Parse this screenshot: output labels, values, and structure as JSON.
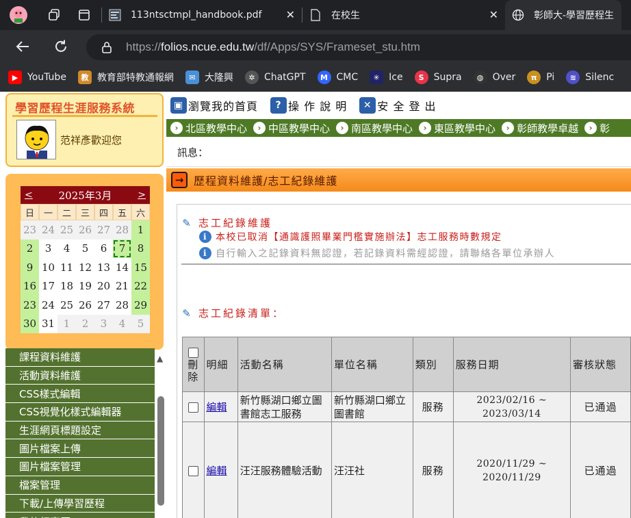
{
  "browser": {
    "tabs": [
      {
        "title": "113ntsctmpl_handbook.pdf",
        "icon": "pdf-icon"
      },
      {
        "title": "在校生",
        "icon": "document-icon"
      },
      {
        "title": "彰師大-學習歷程生",
        "icon": "globe-icon",
        "active": true
      }
    ],
    "url_prefix": "https://",
    "url_domain": "folios.ncue.edu.tw",
    "url_path": "/df/Apps/SYS/Frameset_stu.htm",
    "bookmarks": [
      {
        "label": "YouTube",
        "color": "#ff0000"
      },
      {
        "label": "教育部特教通報網",
        "color": "#d08a2a"
      },
      {
        "label": "大隆興",
        "color": "#4a90d9"
      },
      {
        "label": "ChatGPT",
        "color": "#555555"
      },
      {
        "label": "CMC",
        "color": "#3366ff"
      },
      {
        "label": "Ice",
        "color": "#222266"
      },
      {
        "label": "Supra",
        "color": "#e8344a"
      },
      {
        "label": "Over",
        "color": "#333333"
      },
      {
        "label": "Pi",
        "color": "#c89020"
      },
      {
        "label": "Silenc",
        "color": "#5050c8"
      }
    ]
  },
  "sidebar": {
    "system_title": "學習歷程生涯服務系統",
    "welcome": "范祥彥歡迎您",
    "calendar": {
      "prev": "<",
      "next": ">",
      "month_label": "2025年3月",
      "weekdays": [
        "日",
        "一",
        "二",
        "三",
        "四",
        "五",
        "六"
      ],
      "days": [
        [
          "23",
          "other"
        ],
        [
          "24",
          "other"
        ],
        [
          "25",
          "other"
        ],
        [
          "26",
          "other"
        ],
        [
          "27",
          "other"
        ],
        [
          "28",
          "other"
        ],
        [
          "1",
          "wkend"
        ],
        [
          "2",
          "wkend"
        ],
        [
          "3",
          ""
        ],
        [
          "4",
          ""
        ],
        [
          "5",
          ""
        ],
        [
          "6",
          ""
        ],
        [
          "7",
          "today"
        ],
        [
          "8",
          "wkend"
        ],
        [
          "9",
          "wkend"
        ],
        [
          "10",
          ""
        ],
        [
          "11",
          ""
        ],
        [
          "12",
          ""
        ],
        [
          "13",
          ""
        ],
        [
          "14",
          ""
        ],
        [
          "15",
          "wkend"
        ],
        [
          "16",
          "wkend"
        ],
        [
          "17",
          ""
        ],
        [
          "18",
          ""
        ],
        [
          "19",
          ""
        ],
        [
          "20",
          ""
        ],
        [
          "21",
          ""
        ],
        [
          "22",
          "wkend"
        ],
        [
          "23",
          "wkend"
        ],
        [
          "24",
          ""
        ],
        [
          "25",
          ""
        ],
        [
          "26",
          ""
        ],
        [
          "27",
          ""
        ],
        [
          "28",
          ""
        ],
        [
          "29",
          "wkend"
        ],
        [
          "30",
          "wkend"
        ],
        [
          "31",
          ""
        ],
        [
          "1",
          "other"
        ],
        [
          "2",
          "other"
        ],
        [
          "3",
          "other"
        ],
        [
          "4",
          "other"
        ],
        [
          "5",
          "other"
        ]
      ]
    },
    "menu": [
      "課程資料維護",
      "活動資料維護",
      "CSS樣式編輯",
      "CSS視覺化樣式編輯器",
      "生涯網頁標題設定",
      "圖片檔案上傳",
      "圖片檔案管理",
      "檔案管理",
      "下載/上傳學習歷程",
      "我的行事曆"
    ]
  },
  "toolbar": {
    "home": "瀏覽我的首頁",
    "help": "操 作 說 明",
    "logout": "安 全 登 出"
  },
  "centers": [
    "北區教學中心",
    "中區教學中心",
    "南區教學中心",
    "東區教學中心",
    "彰師教學卓越",
    "彰"
  ],
  "message_label": "訊息：",
  "section_title": "歷程資料維護/志工紀錄維護",
  "content": {
    "heading": "志工紀錄維護",
    "notice1": "本校已取消【通識護照畢業門檻實施辦法】志工服務時數規定",
    "notice2": "自行輸入之記錄資料無認證，若記錄資料需經認證，請聯絡各單位承辦人",
    "list_heading": "志工紀錄清單："
  },
  "table": {
    "headers": {
      "delete": "刪除",
      "detail": "明細",
      "activity": "活動名稱",
      "unit": "單位名稱",
      "type": "類別",
      "date": "服務日期",
      "status": "審核狀態"
    },
    "rows": [
      {
        "edit": "編輯",
        "activity": "新竹縣湖口鄉立圖書館志工服務",
        "unit": "新竹縣湖口鄉立圖書館",
        "type": "服務",
        "date_from": "2023/02/16 ~",
        "date_to": "2023/03/14",
        "status": "已通過"
      },
      {
        "edit": "編輯",
        "activity": "汪汪服務體驗活動",
        "unit": "汪汪社",
        "type": "服務",
        "date_from": "2020/11/29 ~",
        "date_to": "2020/11/29",
        "status": "已通過"
      }
    ]
  }
}
